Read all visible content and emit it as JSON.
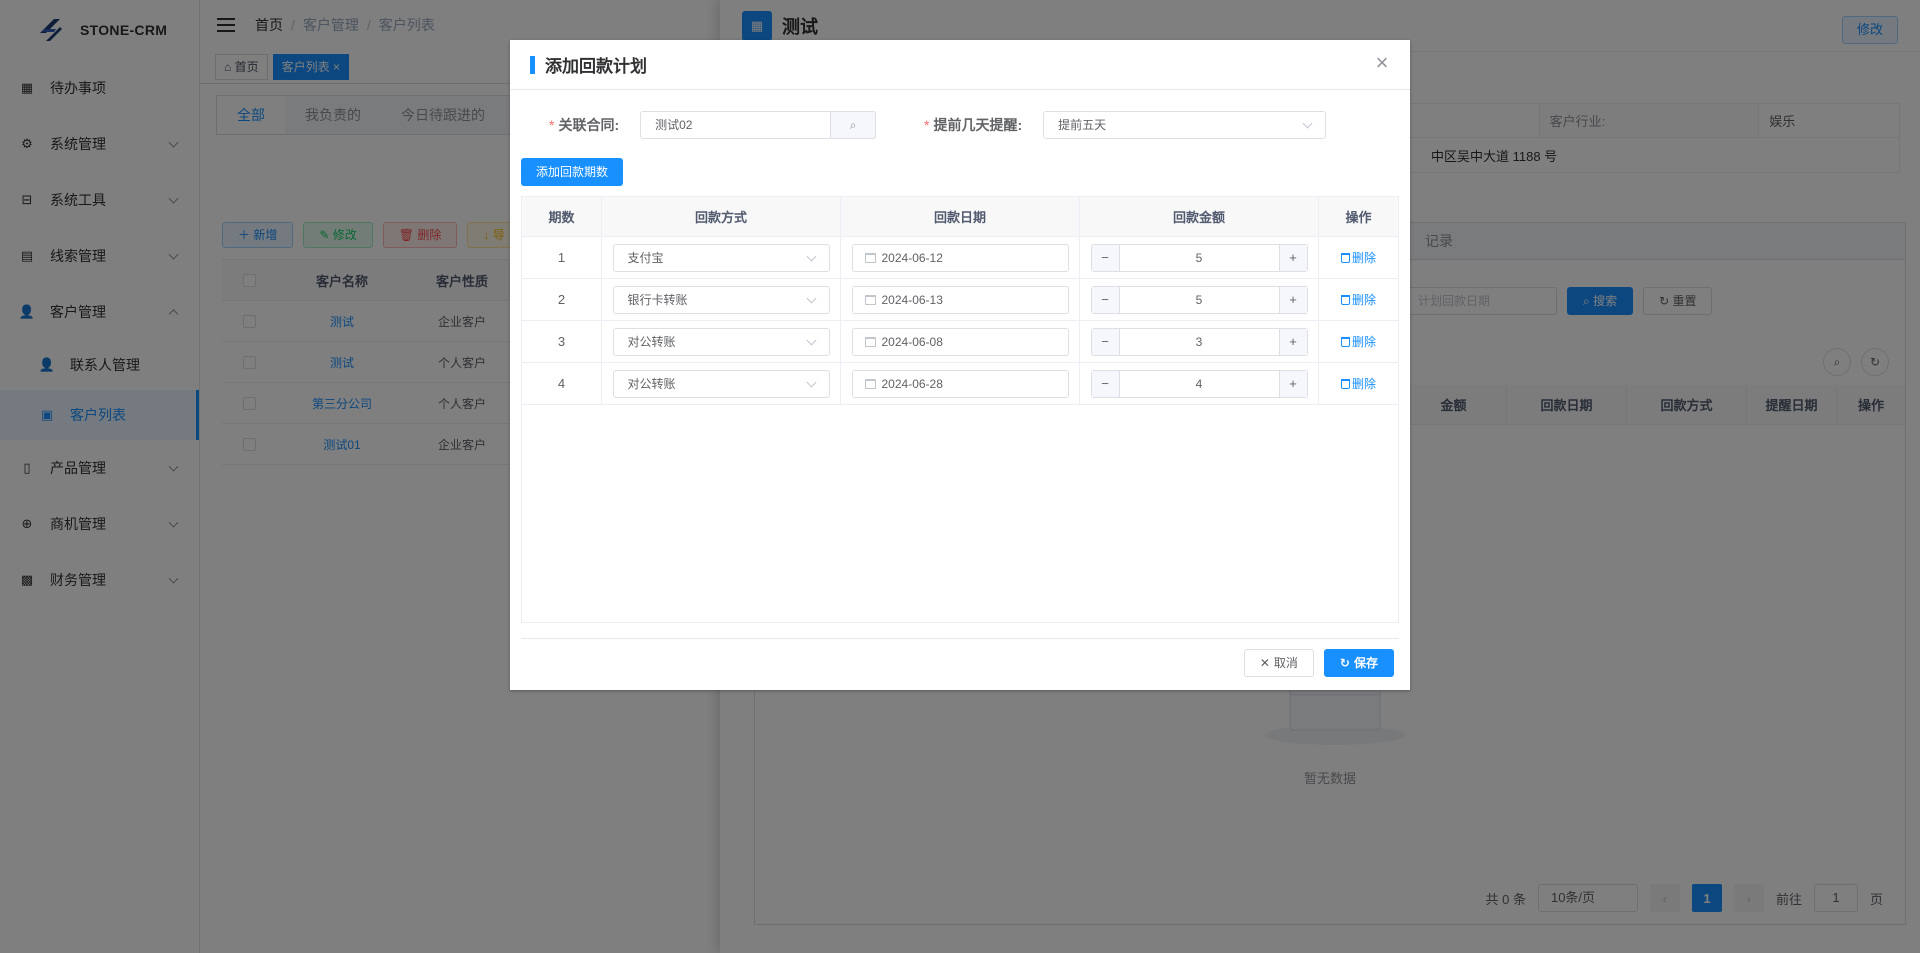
{
  "app": {
    "logo_text": "STONE-CRM",
    "accent": "#1890ff"
  },
  "sidebar": {
    "items": [
      {
        "label": "待办事项",
        "icon": "grid-icon",
        "expandable": false
      },
      {
        "label": "系统管理",
        "icon": "gear-icon",
        "expandable": true
      },
      {
        "label": "系统工具",
        "icon": "toolbox-icon",
        "expandable": true
      },
      {
        "label": "线索管理",
        "icon": "clue-icon",
        "expandable": true
      },
      {
        "label": "客户管理",
        "icon": "users-icon",
        "expandable": true,
        "expanded": true
      },
      {
        "label": "联系人管理",
        "icon": "contact-icon",
        "sub": true
      },
      {
        "label": "客户列表",
        "icon": "list-icon",
        "sub": true,
        "active": true
      },
      {
        "label": "产品管理",
        "icon": "book-icon",
        "expandable": true
      },
      {
        "label": "商机管理",
        "icon": "opportunity-icon",
        "expandable": true
      },
      {
        "label": "财务管理",
        "icon": "finance-icon",
        "expandable": true
      }
    ]
  },
  "breadcrumb": {
    "home": "首页",
    "level2": "客户管理",
    "level3": "客户列表"
  },
  "tags": {
    "home": "首页",
    "current": "客户列表"
  },
  "list_tabs": [
    "全部",
    "我负责的",
    "今日待跟进的"
  ],
  "list_buttons": {
    "add": "新增",
    "edit": "修改",
    "delete": "删除",
    "export": "导"
  },
  "customer_table": {
    "headers": [
      "客户名称",
      "客户性质"
    ],
    "rows": [
      {
        "name": "测试",
        "type": "企业客户"
      },
      {
        "name": "测试",
        "type": "个人客户"
      },
      {
        "name": "第三分公司",
        "type": "个人客户"
      },
      {
        "name": "测试01",
        "type": "企业客户"
      }
    ]
  },
  "drawer": {
    "title": "测试",
    "edit_label": "修改",
    "industry_label": "客户行业:",
    "industry_value": "娱乐",
    "address": "中区吴中大道 1188 号",
    "tab_label": "记录",
    "search_placeholder": "计划回款日期",
    "search_btn": "搜索",
    "reset_btn": "重置",
    "headers": [
      "金额",
      "回款日期",
      "回款方式",
      "提醒日期",
      "操作"
    ],
    "empty": "暂无数据",
    "pager": {
      "total": "共 0 条",
      "page_size": "10条/页",
      "current": "1",
      "goto_label": "前往",
      "goto_value": "1",
      "page_suffix": "页"
    }
  },
  "modal": {
    "title": "添加回款计划",
    "contract_label": "关联合同:",
    "contract_value": "测试02",
    "remind_label": "提前几天提醒:",
    "remind_value": "提前五天",
    "add_btn": "添加回款期数",
    "headers": [
      "期数",
      "回款方式",
      "回款日期",
      "回款金额",
      "操作"
    ],
    "rows": [
      {
        "period": "1",
        "method": "支付宝",
        "date": "2024-06-12",
        "amount": "5"
      },
      {
        "period": "2",
        "method": "银行卡转账",
        "date": "2024-06-13",
        "amount": "5"
      },
      {
        "period": "3",
        "method": "对公转账",
        "date": "2024-06-08",
        "amount": "3"
      },
      {
        "period": "4",
        "method": "对公转账",
        "date": "2024-06-28",
        "amount": "4"
      }
    ],
    "delete_label": "删除",
    "cancel_label": "取消",
    "save_label": "保存"
  }
}
